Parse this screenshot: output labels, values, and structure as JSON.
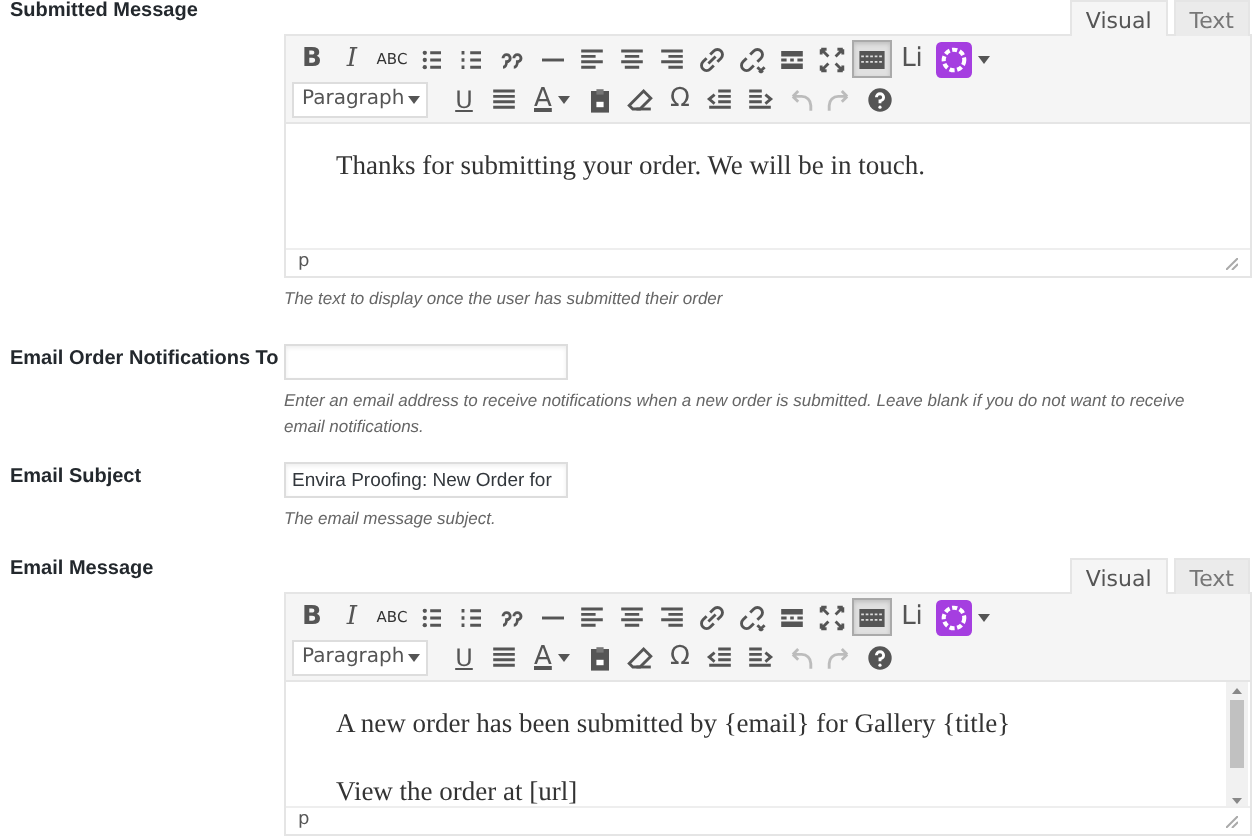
{
  "fields": [
    {
      "kind": "editor",
      "label": "Submitted Message",
      "editor": {
        "tabs": [
          {
            "label": "Visual",
            "selected": true
          },
          {
            "label": "Text",
            "selected": false
          }
        ],
        "toolbar_row_1": [
          {
            "kind": "bold",
            "label": "B",
            "pressed": false,
            "disabled": false
          },
          {
            "kind": "italic",
            "label": "I",
            "pressed": false,
            "disabled": false
          },
          {
            "kind": "strike",
            "label": "ABC",
            "pressed": false,
            "disabled": false
          },
          {
            "kind": "bullist",
            "pressed": false,
            "disabled": false
          },
          {
            "kind": "numlist",
            "pressed": false,
            "disabled": false
          },
          {
            "kind": "quote",
            "pressed": false,
            "disabled": false
          },
          {
            "kind": "hr",
            "pressed": false,
            "disabled": false
          },
          {
            "kind": "alignleft",
            "pressed": false,
            "disabled": false
          },
          {
            "kind": "aligncenter",
            "pressed": false,
            "disabled": false
          },
          {
            "kind": "alignright",
            "pressed": false,
            "disabled": false
          },
          {
            "kind": "link",
            "pressed": false,
            "disabled": false
          },
          {
            "kind": "unlink",
            "pressed": false,
            "disabled": false
          },
          {
            "kind": "more",
            "pressed": false,
            "disabled": false
          },
          {
            "kind": "fullscreen",
            "pressed": false,
            "disabled": false
          },
          {
            "kind": "toggle",
            "pressed": true,
            "disabled": false
          },
          {
            "kind": "text",
            "label": "Li",
            "pressed": false,
            "disabled": false
          },
          {
            "kind": "plugin",
            "pressed": false,
            "disabled": false
          }
        ],
        "format": "Paragraph",
        "toolbar_row_2": [
          {
            "kind": "underline",
            "label": "U",
            "pressed": false,
            "disabled": false
          },
          {
            "kind": "justify",
            "pressed": false,
            "disabled": false
          },
          {
            "kind": "color",
            "label": "A",
            "pressed": false,
            "disabled": false
          },
          {
            "kind": "paste",
            "pressed": false,
            "disabled": false
          },
          {
            "kind": "eraser",
            "pressed": false,
            "disabled": false
          },
          {
            "kind": "text",
            "label": "Ω",
            "pressed": false,
            "disabled": false
          },
          {
            "kind": "outdent",
            "pressed": false,
            "disabled": false
          },
          {
            "kind": "indent",
            "pressed": false,
            "disabled": false
          },
          {
            "kind": "undo",
            "pressed": false,
            "disabled": true
          },
          {
            "kind": "redo",
            "pressed": false,
            "disabled": true
          },
          {
            "kind": "help",
            "pressed": false,
            "disabled": false
          }
        ],
        "paragraphs": [
          "Thanks for submitting your order. We will be in touch."
        ],
        "scrollable": false,
        "path": "p"
      },
      "help": "The text to display once the user has submitted their order"
    },
    {
      "kind": "text",
      "label": "Email Order Notifications To",
      "help": "Enter an email address to receive notifications when a new order is submitted. Leave blank if you do not want to receive email notifications."
    },
    {
      "kind": "text",
      "label": "Email Subject",
      "value": "Envira Proofing: New Order for",
      "help": "The email message subject."
    },
    {
      "kind": "editor",
      "label": "Email Message",
      "editor": {
        "tabs": [
          {
            "label": "Visual",
            "selected": true
          },
          {
            "label": "Text",
            "selected": false
          }
        ],
        "toolbar_row_1": [
          {
            "kind": "bold",
            "label": "B",
            "pressed": false,
            "disabled": false
          },
          {
            "kind": "italic",
            "label": "I",
            "pressed": false,
            "disabled": false
          },
          {
            "kind": "strike",
            "label": "ABC",
            "pressed": false,
            "disabled": false
          },
          {
            "kind": "bullist",
            "pressed": false,
            "disabled": false
          },
          {
            "kind": "numlist",
            "pressed": false,
            "disabled": false
          },
          {
            "kind": "quote",
            "pressed": false,
            "disabled": false
          },
          {
            "kind": "hr",
            "pressed": false,
            "disabled": false
          },
          {
            "kind": "alignleft",
            "pressed": false,
            "disabled": false
          },
          {
            "kind": "aligncenter",
            "pressed": false,
            "disabled": false
          },
          {
            "kind": "alignright",
            "pressed": false,
            "disabled": false
          },
          {
            "kind": "link",
            "pressed": false,
            "disabled": false
          },
          {
            "kind": "unlink",
            "pressed": false,
            "disabled": false
          },
          {
            "kind": "more",
            "pressed": false,
            "disabled": false
          },
          {
            "kind": "fullscreen",
            "pressed": false,
            "disabled": false
          },
          {
            "kind": "toggle",
            "pressed": true,
            "disabled": false
          },
          {
            "kind": "text",
            "label": "Li",
            "pressed": false,
            "disabled": false
          },
          {
            "kind": "plugin",
            "pressed": false,
            "disabled": false
          }
        ],
        "format": "Paragraph",
        "toolbar_row_2": [
          {
            "kind": "underline",
            "label": "U",
            "pressed": false,
            "disabled": false
          },
          {
            "kind": "justify",
            "pressed": false,
            "disabled": false
          },
          {
            "kind": "color",
            "label": "A",
            "pressed": false,
            "disabled": false
          },
          {
            "kind": "paste",
            "pressed": false,
            "disabled": false
          },
          {
            "kind": "eraser",
            "pressed": false,
            "disabled": false
          },
          {
            "kind": "text",
            "label": "Ω",
            "pressed": false,
            "disabled": false
          },
          {
            "kind": "outdent",
            "pressed": false,
            "disabled": false
          },
          {
            "kind": "indent",
            "pressed": false,
            "disabled": false
          },
          {
            "kind": "undo",
            "pressed": false,
            "disabled": true
          },
          {
            "kind": "redo",
            "pressed": false,
            "disabled": true
          },
          {
            "kind": "help",
            "pressed": false,
            "disabled": false
          }
        ],
        "paragraphs": [
          "A new order has been submitted by {email} for Gallery {title}",
          "View the order at [url]"
        ],
        "scrollable": true,
        "path": "p"
      }
    }
  ]
}
